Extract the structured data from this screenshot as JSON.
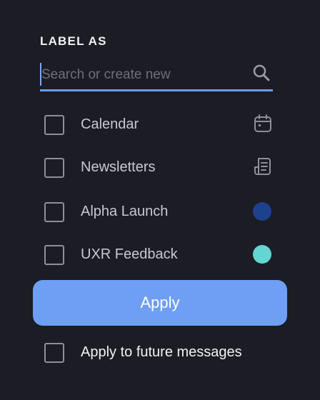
{
  "colors": {
    "background": "#1b1c24",
    "accent": "#6e9ff5",
    "dot_alpha_launch": "#1e418f",
    "dot_uxr_feedback": "#63d6d3"
  },
  "heading": "LABEL AS",
  "search": {
    "placeholder": "Search or create new",
    "value": "",
    "icon": "search-icon"
  },
  "labels": [
    {
      "name": "Calendar",
      "checked": false,
      "icon": "calendar-icon"
    },
    {
      "name": "Newsletters",
      "checked": false,
      "icon": "newsletter-icon"
    },
    {
      "name": "Alpha Launch",
      "checked": false,
      "icon": "color-dot",
      "color": "#1e418f"
    },
    {
      "name": "UXR Feedback",
      "checked": false,
      "icon": "color-dot",
      "color": "#63d6d3"
    }
  ],
  "apply_label": "Apply",
  "future": {
    "label": "Apply to future messages",
    "checked": false
  }
}
